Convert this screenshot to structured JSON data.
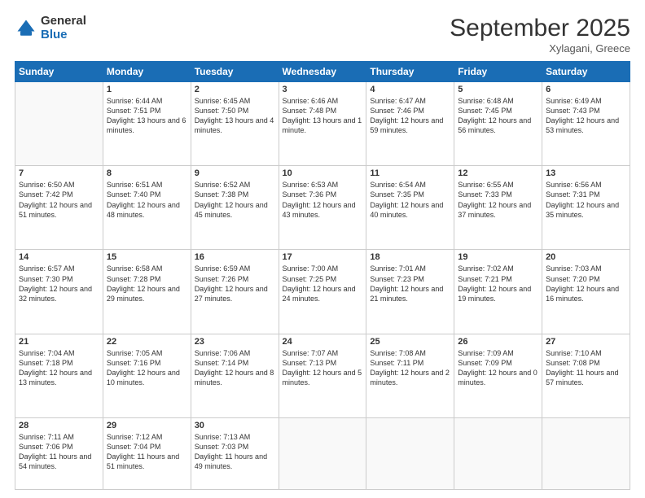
{
  "logo": {
    "general": "General",
    "blue": "Blue"
  },
  "header": {
    "month": "September 2025",
    "location": "Xylagani, Greece"
  },
  "weekdays": [
    "Sunday",
    "Monday",
    "Tuesday",
    "Wednesday",
    "Thursday",
    "Friday",
    "Saturday"
  ],
  "weeks": [
    [
      {
        "day": "",
        "sunrise": "",
        "sunset": "",
        "daylight": ""
      },
      {
        "day": "1",
        "sunrise": "Sunrise: 6:44 AM",
        "sunset": "Sunset: 7:51 PM",
        "daylight": "Daylight: 13 hours and 6 minutes."
      },
      {
        "day": "2",
        "sunrise": "Sunrise: 6:45 AM",
        "sunset": "Sunset: 7:50 PM",
        "daylight": "Daylight: 13 hours and 4 minutes."
      },
      {
        "day": "3",
        "sunrise": "Sunrise: 6:46 AM",
        "sunset": "Sunset: 7:48 PM",
        "daylight": "Daylight: 13 hours and 1 minute."
      },
      {
        "day": "4",
        "sunrise": "Sunrise: 6:47 AM",
        "sunset": "Sunset: 7:46 PM",
        "daylight": "Daylight: 12 hours and 59 minutes."
      },
      {
        "day": "5",
        "sunrise": "Sunrise: 6:48 AM",
        "sunset": "Sunset: 7:45 PM",
        "daylight": "Daylight: 12 hours and 56 minutes."
      },
      {
        "day": "6",
        "sunrise": "Sunrise: 6:49 AM",
        "sunset": "Sunset: 7:43 PM",
        "daylight": "Daylight: 12 hours and 53 minutes."
      }
    ],
    [
      {
        "day": "7",
        "sunrise": "Sunrise: 6:50 AM",
        "sunset": "Sunset: 7:42 PM",
        "daylight": "Daylight: 12 hours and 51 minutes."
      },
      {
        "day": "8",
        "sunrise": "Sunrise: 6:51 AM",
        "sunset": "Sunset: 7:40 PM",
        "daylight": "Daylight: 12 hours and 48 minutes."
      },
      {
        "day": "9",
        "sunrise": "Sunrise: 6:52 AM",
        "sunset": "Sunset: 7:38 PM",
        "daylight": "Daylight: 12 hours and 45 minutes."
      },
      {
        "day": "10",
        "sunrise": "Sunrise: 6:53 AM",
        "sunset": "Sunset: 7:36 PM",
        "daylight": "Daylight: 12 hours and 43 minutes."
      },
      {
        "day": "11",
        "sunrise": "Sunrise: 6:54 AM",
        "sunset": "Sunset: 7:35 PM",
        "daylight": "Daylight: 12 hours and 40 minutes."
      },
      {
        "day": "12",
        "sunrise": "Sunrise: 6:55 AM",
        "sunset": "Sunset: 7:33 PM",
        "daylight": "Daylight: 12 hours and 37 minutes."
      },
      {
        "day": "13",
        "sunrise": "Sunrise: 6:56 AM",
        "sunset": "Sunset: 7:31 PM",
        "daylight": "Daylight: 12 hours and 35 minutes."
      }
    ],
    [
      {
        "day": "14",
        "sunrise": "Sunrise: 6:57 AM",
        "sunset": "Sunset: 7:30 PM",
        "daylight": "Daylight: 12 hours and 32 minutes."
      },
      {
        "day": "15",
        "sunrise": "Sunrise: 6:58 AM",
        "sunset": "Sunset: 7:28 PM",
        "daylight": "Daylight: 12 hours and 29 minutes."
      },
      {
        "day": "16",
        "sunrise": "Sunrise: 6:59 AM",
        "sunset": "Sunset: 7:26 PM",
        "daylight": "Daylight: 12 hours and 27 minutes."
      },
      {
        "day": "17",
        "sunrise": "Sunrise: 7:00 AM",
        "sunset": "Sunset: 7:25 PM",
        "daylight": "Daylight: 12 hours and 24 minutes."
      },
      {
        "day": "18",
        "sunrise": "Sunrise: 7:01 AM",
        "sunset": "Sunset: 7:23 PM",
        "daylight": "Daylight: 12 hours and 21 minutes."
      },
      {
        "day": "19",
        "sunrise": "Sunrise: 7:02 AM",
        "sunset": "Sunset: 7:21 PM",
        "daylight": "Daylight: 12 hours and 19 minutes."
      },
      {
        "day": "20",
        "sunrise": "Sunrise: 7:03 AM",
        "sunset": "Sunset: 7:20 PM",
        "daylight": "Daylight: 12 hours and 16 minutes."
      }
    ],
    [
      {
        "day": "21",
        "sunrise": "Sunrise: 7:04 AM",
        "sunset": "Sunset: 7:18 PM",
        "daylight": "Daylight: 12 hours and 13 minutes."
      },
      {
        "day": "22",
        "sunrise": "Sunrise: 7:05 AM",
        "sunset": "Sunset: 7:16 PM",
        "daylight": "Daylight: 12 hours and 10 minutes."
      },
      {
        "day": "23",
        "sunrise": "Sunrise: 7:06 AM",
        "sunset": "Sunset: 7:14 PM",
        "daylight": "Daylight: 12 hours and 8 minutes."
      },
      {
        "day": "24",
        "sunrise": "Sunrise: 7:07 AM",
        "sunset": "Sunset: 7:13 PM",
        "daylight": "Daylight: 12 hours and 5 minutes."
      },
      {
        "day": "25",
        "sunrise": "Sunrise: 7:08 AM",
        "sunset": "Sunset: 7:11 PM",
        "daylight": "Daylight: 12 hours and 2 minutes."
      },
      {
        "day": "26",
        "sunrise": "Sunrise: 7:09 AM",
        "sunset": "Sunset: 7:09 PM",
        "daylight": "Daylight: 12 hours and 0 minutes."
      },
      {
        "day": "27",
        "sunrise": "Sunrise: 7:10 AM",
        "sunset": "Sunset: 7:08 PM",
        "daylight": "Daylight: 11 hours and 57 minutes."
      }
    ],
    [
      {
        "day": "28",
        "sunrise": "Sunrise: 7:11 AM",
        "sunset": "Sunset: 7:06 PM",
        "daylight": "Daylight: 11 hours and 54 minutes."
      },
      {
        "day": "29",
        "sunrise": "Sunrise: 7:12 AM",
        "sunset": "Sunset: 7:04 PM",
        "daylight": "Daylight: 11 hours and 51 minutes."
      },
      {
        "day": "30",
        "sunrise": "Sunrise: 7:13 AM",
        "sunset": "Sunset: 7:03 PM",
        "daylight": "Daylight: 11 hours and 49 minutes."
      },
      {
        "day": "",
        "sunrise": "",
        "sunset": "",
        "daylight": ""
      },
      {
        "day": "",
        "sunrise": "",
        "sunset": "",
        "daylight": ""
      },
      {
        "day": "",
        "sunrise": "",
        "sunset": "",
        "daylight": ""
      },
      {
        "day": "",
        "sunrise": "",
        "sunset": "",
        "daylight": ""
      }
    ]
  ]
}
